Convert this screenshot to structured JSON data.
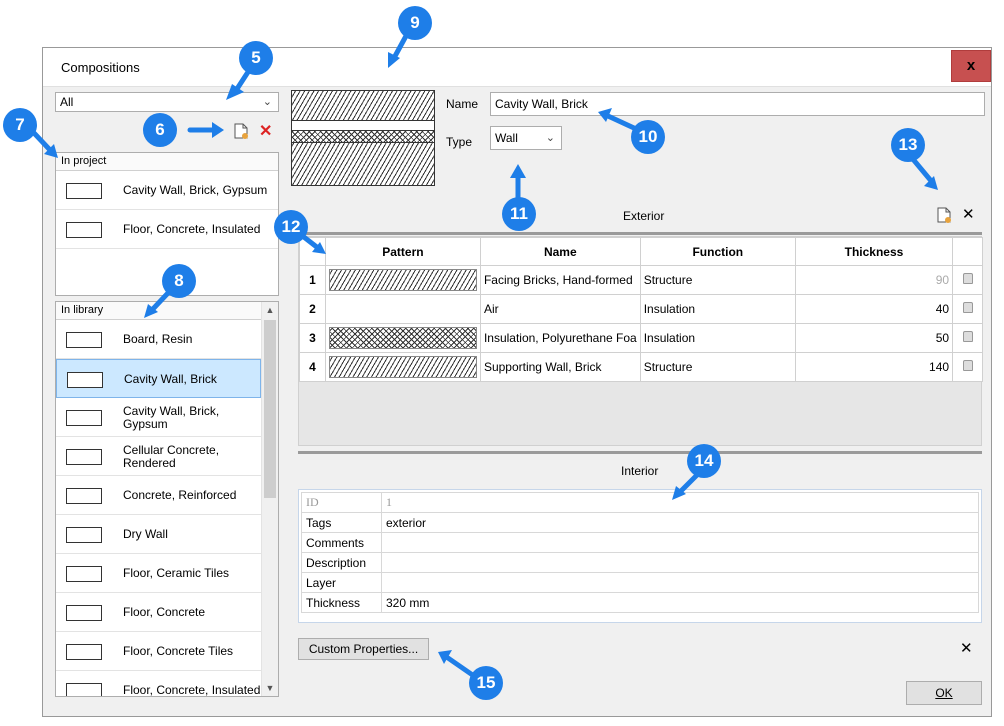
{
  "window": {
    "title": "Compositions",
    "close": "x"
  },
  "filter": {
    "value": "All"
  },
  "panels": {
    "in_project": "In project",
    "in_library": "In library"
  },
  "project_items": [
    {
      "label": "Cavity Wall, Brick, Gypsum",
      "pattern": "diag"
    },
    {
      "label": "Floor, Concrete, Insulated",
      "pattern": "dots"
    }
  ],
  "library_items": [
    {
      "label": "Board, Resin",
      "pattern": "vert"
    },
    {
      "label": "Cavity Wall, Brick",
      "pattern": "diag"
    },
    {
      "label": "Cavity Wall, Brick, Gypsum",
      "pattern": "diag"
    },
    {
      "label": "Cellular Concrete, Rendered",
      "pattern": "cross"
    },
    {
      "label": "Concrete, Reinforced",
      "pattern": "dots"
    },
    {
      "label": "Dry Wall",
      "pattern": "horiz"
    },
    {
      "label": "Floor, Ceramic Tiles",
      "pattern": "vert"
    },
    {
      "label": "Floor, Concrete",
      "pattern": "dots"
    },
    {
      "label": "Floor, Concrete Tiles",
      "pattern": "vert"
    },
    {
      "label": "Floor, Concrete, Insulated",
      "pattern": "dots"
    }
  ],
  "form": {
    "name_label": "Name",
    "name_value": "Cavity Wall, Brick",
    "type_label": "Type",
    "type_value": "Wall"
  },
  "exterior_label": "Exterior",
  "interior_label": "Interior",
  "layers": {
    "headers": [
      "Pattern",
      "Name",
      "Function",
      "Thickness"
    ],
    "rows": [
      {
        "n": "1",
        "name": "Facing Bricks, Hand-formed",
        "function": "Structure",
        "thickness": "90",
        "pattern": "diag"
      },
      {
        "n": "2",
        "name": "Air",
        "function": "Insulation",
        "thickness": "40",
        "pattern": "none"
      },
      {
        "n": "3",
        "name": "Insulation, Polyurethane Foa",
        "function": "Insulation",
        "thickness": "50",
        "pattern": "cross"
      },
      {
        "n": "4",
        "name": "Supporting Wall, Brick",
        "function": "Structure",
        "thickness": "140",
        "pattern": "diag"
      }
    ]
  },
  "properties": [
    {
      "key": "ID",
      "value": "1"
    },
    {
      "key": "Tags",
      "value": "exterior"
    },
    {
      "key": "Comments",
      "value": ""
    },
    {
      "key": "Description",
      "value": ""
    },
    {
      "key": "Layer",
      "value": ""
    },
    {
      "key": "Thickness",
      "value": "320 mm"
    }
  ],
  "buttons": {
    "custom": "Custom Properties...",
    "ok": "OK",
    "new_icon": "new-icon",
    "delete_icon": "✕",
    "close_x": "✕"
  },
  "callouts": [
    "5",
    "6",
    "7",
    "8",
    "9",
    "10",
    "11",
    "12",
    "13",
    "14",
    "15"
  ],
  "colors": {
    "callout": "#1e7ee8",
    "selection": "#cce8ff",
    "close_bg": "#c75050"
  }
}
